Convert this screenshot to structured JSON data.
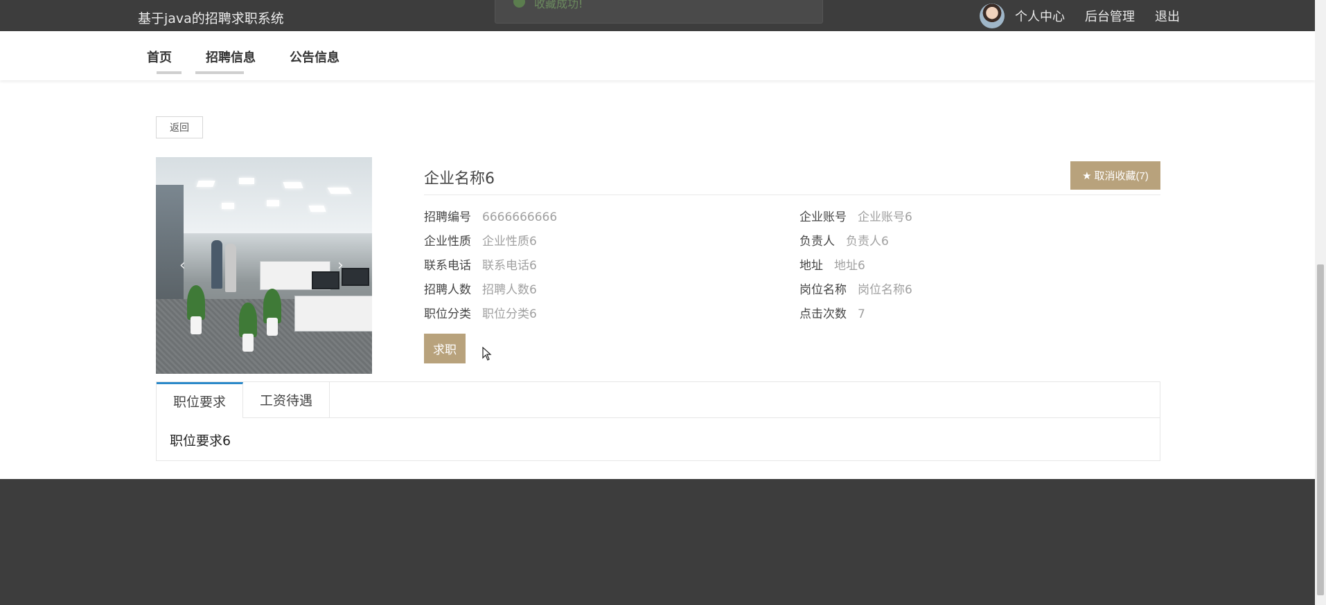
{
  "header": {
    "site_title": "基于java的招聘求职系统",
    "links": [
      "个人中心",
      "后台管理",
      "退出"
    ],
    "toast_text": "收藏成功!"
  },
  "nav": {
    "items": [
      "首页",
      "招聘信息",
      "公告信息"
    ]
  },
  "back_label": "返回",
  "detail": {
    "company_name": "企业名称6",
    "favorite_label": "取消收藏(7)",
    "fields_left": [
      {
        "key": "招聘编号",
        "value": "6666666666"
      },
      {
        "key": "企业性质",
        "value": "企业性质6"
      },
      {
        "key": "联系电话",
        "value": "联系电话6"
      },
      {
        "key": "招聘人数",
        "value": "招聘人数6"
      },
      {
        "key": "职位分类",
        "value": "职位分类6"
      }
    ],
    "fields_right": [
      {
        "key": "企业账号",
        "value": "企业账号6"
      },
      {
        "key": "负责人",
        "value": "负责人6"
      },
      {
        "key": "地址",
        "value": "地址6"
      },
      {
        "key": "岗位名称",
        "value": "岗位名称6"
      },
      {
        "key": "点击次数",
        "value": "7"
      }
    ],
    "apply_label": "求职"
  },
  "carousel": {
    "prev": "‹",
    "next": "›"
  },
  "tabs": {
    "items": [
      "职位要求",
      "工资待遇"
    ],
    "active_content": "职位要求6"
  },
  "colors": {
    "accent": "#b8a27c",
    "topbar": "#3d3d3d",
    "tab_active": "#2b89c9"
  }
}
